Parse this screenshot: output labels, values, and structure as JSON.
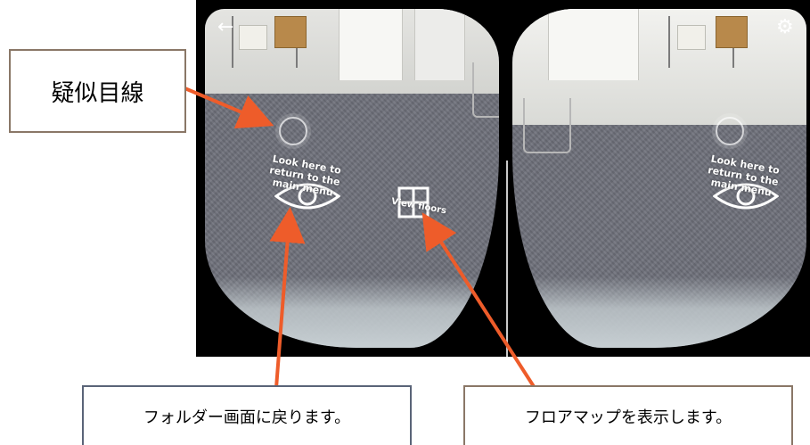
{
  "viewer": {
    "left_eye": {
      "look_text": "Look here to return to the main menu",
      "view_floors": "View floors"
    },
    "right_eye": {
      "look_text": "Look here to return to the main menu"
    },
    "icons": {
      "back": "arrow-left",
      "settings": "gear"
    }
  },
  "callouts": {
    "gaze": "疑似目線",
    "return_folder": "フォルダー画面に戻ります。",
    "floor_map": "フロアマップを表示します。"
  },
  "colors": {
    "arrow": "#ee5c2a",
    "callout_border": "#8a7767"
  }
}
